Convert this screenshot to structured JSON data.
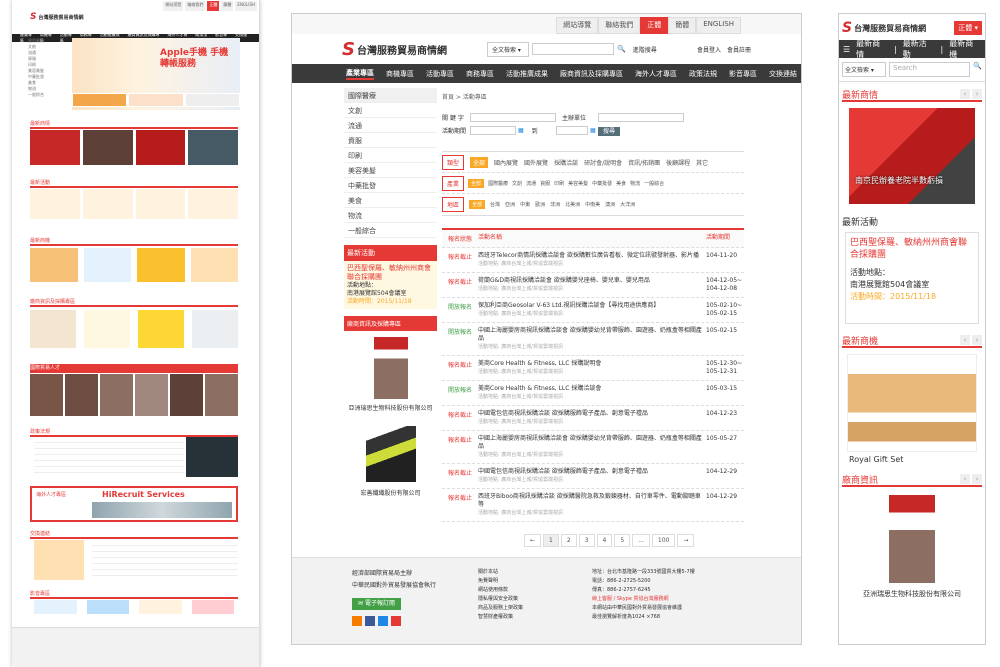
{
  "brand": {
    "name": "台灣服務貿易商情網",
    "accent": "#e53935",
    "dark": "#3a3a3a",
    "orange": "#f9a825"
  },
  "topbar": {
    "items": [
      "網站導覽",
      "聯絡我們",
      "正體",
      "簡體",
      "ENGLISH"
    ],
    "active_index": 2
  },
  "search": {
    "scope": "全文檢索",
    "placeholder": "",
    "advanced": "進階搜尋"
  },
  "account": {
    "login": "會員登入",
    "register": "會員註冊"
  },
  "nav": [
    "產業專區",
    "商機專區",
    "活動專區",
    "商務專區",
    "活動推廣成果",
    "廠商資訊及採購專區",
    "海外人才專區",
    "政策法規",
    "影音專區",
    "交換連結"
  ],
  "sidemenu": [
    "國際醫療",
    "文創",
    "流通",
    "資服",
    "印刷",
    "美容美髮",
    "中藥批發",
    "美食",
    "物流",
    "一般綜合"
  ],
  "breadcrumb": "首頁 > 活動專區",
  "form": {
    "keyword": "關 鍵 字",
    "organizer": "主辦單位",
    "period": "活動期間",
    "to": "到",
    "submit": "搜尋"
  },
  "filters": [
    {
      "label": "類型",
      "options": [
        "全部",
        "國內展覽",
        "國外展覽",
        "採購洽談",
        "研討會/說明會",
        "資訊/拓銷團",
        "後顧課程",
        "其它"
      ]
    },
    {
      "label": "產業",
      "options": [
        "全部",
        "國際醫療",
        "文創",
        "流通",
        "資服",
        "印刷",
        "美容美髮",
        "中藥批發",
        "美食",
        "物流",
        "一般綜合"
      ]
    },
    {
      "label": "地區",
      "options": [
        "全部",
        "台灣",
        "亞洲",
        "中東",
        "歐洲",
        "非洲",
        "北美洲",
        "中南美",
        "澳洲",
        "大洋洲"
      ]
    }
  ],
  "table": {
    "headers": {
      "status": "報名狀態",
      "name": "活動名稱",
      "date": "活動期間"
    },
    "rows": [
      {
        "status": "報名截止",
        "sc": "r",
        "name": "西班牙Telecor商情訊採購洽談會 欲採購數位廣告看板、微定位訊號發射器、影片播",
        "sub": "活動地點: 廣商台灣上城/貿協雲端視訊",
        "date": "104-11-20"
      },
      {
        "status": "報名截止",
        "sc": "r",
        "name": "荷蘭G&D商視訊採購洽談會 欲採購嬰兒座椅、嬰兒車、嬰兒用品",
        "sub": "活動地點: 廣商台灣上城/貿協雲端視訊",
        "date": "104-12-05~ 104-12-08"
      },
      {
        "status": "開放報名",
        "sc": "g",
        "name": "保加利亞商Geosolar V-63 Ltd.視訊採購洽談會【尋找用途供應商】",
        "sub": "活動地點: 廣商台灣上城/貿協雲端視訊",
        "date": "105-02-10~ 105-02-15"
      },
      {
        "status": "開放報名",
        "sc": "g",
        "name": "中國上海麗嬰房商視訊採購洽談會 欲採購嬰幼兒背帶服飾、園遊器、奶瓶盒等相關產品",
        "sub": "活動地點: 廣商台灣上城/貿協雲端視訊",
        "date": "105-02-15"
      },
      {
        "status": "報名截止",
        "sc": "r",
        "name": "美商Core Health & Fitness, LLC 採購說明會",
        "sub": "活動地點: 廣商台灣上城/貿協雲端視訊",
        "date": "105-12-30~ 105-12-31"
      },
      {
        "status": "開放報名",
        "sc": "g",
        "name": "美商Core Health & Fitness, LLC 採購洽談會",
        "sub": "活動地點: 廣商台灣上城/貿協雲端視訊",
        "date": "105-03-15"
      },
      {
        "status": "報名截止",
        "sc": "r",
        "name": "中國電包信商視訊採購洽談 欲採購服飾電子產品、創意電子禮品",
        "sub": "活動地點: 廣商台灣上城/貿協雲端視訊",
        "date": "104-12-23"
      },
      {
        "status": "報名截止",
        "sc": "r",
        "name": "中國上海麗嬰房商視訊採購洽談會 欲採購嬰幼兒背帶服飾、園遊器、奶瓶盒等相關產品",
        "sub": "活動地點: 廣商台灣上城/貿協雲端視訊",
        "date": "105-05-27"
      },
      {
        "status": "報名截止",
        "sc": "r",
        "name": "中國電包信商視訊採購洽談 欲採購服飾電子產品、創意電子禮品",
        "sub": "活動地點: 廣商台灣上城/貿協雲端視訊",
        "date": "104-12-29"
      },
      {
        "status": "報名截止",
        "sc": "r",
        "name": "西班牙Biboo商視訊採購洽談 欲採購醫院急救及鍛鍊器材、自行車零件、電動腳踏車等",
        "sub": "活動地點: 廣商台灣上城/貿協雲端視訊",
        "date": "104-12-29"
      }
    ]
  },
  "pager": [
    "←",
    "1",
    "2",
    "3",
    "4",
    "5",
    "...",
    "100",
    "→"
  ],
  "latest_event": {
    "title": "最新活動",
    "name": "巴西聖保羅、敏納州州商會聯合採購團",
    "place_label": "活動地點：",
    "place": "南港展覽館504會議室",
    "time": "活動時間：2015/11/18"
  },
  "vendor_section": {
    "title": "廠商資訊及採購專區",
    "items": [
      "亞洲瑞思生物科技股份有限公司",
      "宏善纖織股份有限公司"
    ]
  },
  "footer": {
    "org1": "經濟部國際貿易局主辦",
    "org2": "中華民國對外貿易發展協會執行",
    "subscribe": "電子報訂閱",
    "links": [
      "關於本站",
      "免費聲明",
      "網站使用條款",
      "隱私權與安全政策",
      "商品及服務上架政策",
      "智慧財產權政策"
    ],
    "address": "地址：台北市基隆路一段333號國貿大樓5-7樓",
    "tel": "電話：886-2-2725-5200",
    "fax": "傳真：886-2-2757-6245",
    "contact": "線上客服 / Skype 貿協台灣服務網",
    "note1": "本網站由中華民國對外貿易發展協會維護",
    "note2": "最佳瀏覽解析度為1024 ×768"
  },
  "mobile": {
    "lang": "正體",
    "menu": [
      "最新商情",
      "最新活動",
      "最新商機"
    ],
    "search_scope": "全文檢索",
    "search_placeholder": "Search",
    "news_title": "最新商情",
    "news_caption": "南京民辦養老院半數虧損",
    "event_title": "最新活動",
    "biz_title": "最新商機",
    "biz_caption": "Royal Gift Set",
    "vendor_title": "廠商資訊",
    "vendor_caption": "亞洲瑞思生物科技股份有限公司"
  },
  "desktop_small": {
    "banner": "Apple手機 手機轉帳服務",
    "section_titles": [
      "最新商情",
      "最新活動",
      "最新商機",
      "廠商資訊及採購專區",
      "國際貿易人才",
      "政策法規",
      "交換連結",
      "影音專區"
    ],
    "hiring": "海外人才專區",
    "hirecruit": "HiRecruit Services"
  }
}
